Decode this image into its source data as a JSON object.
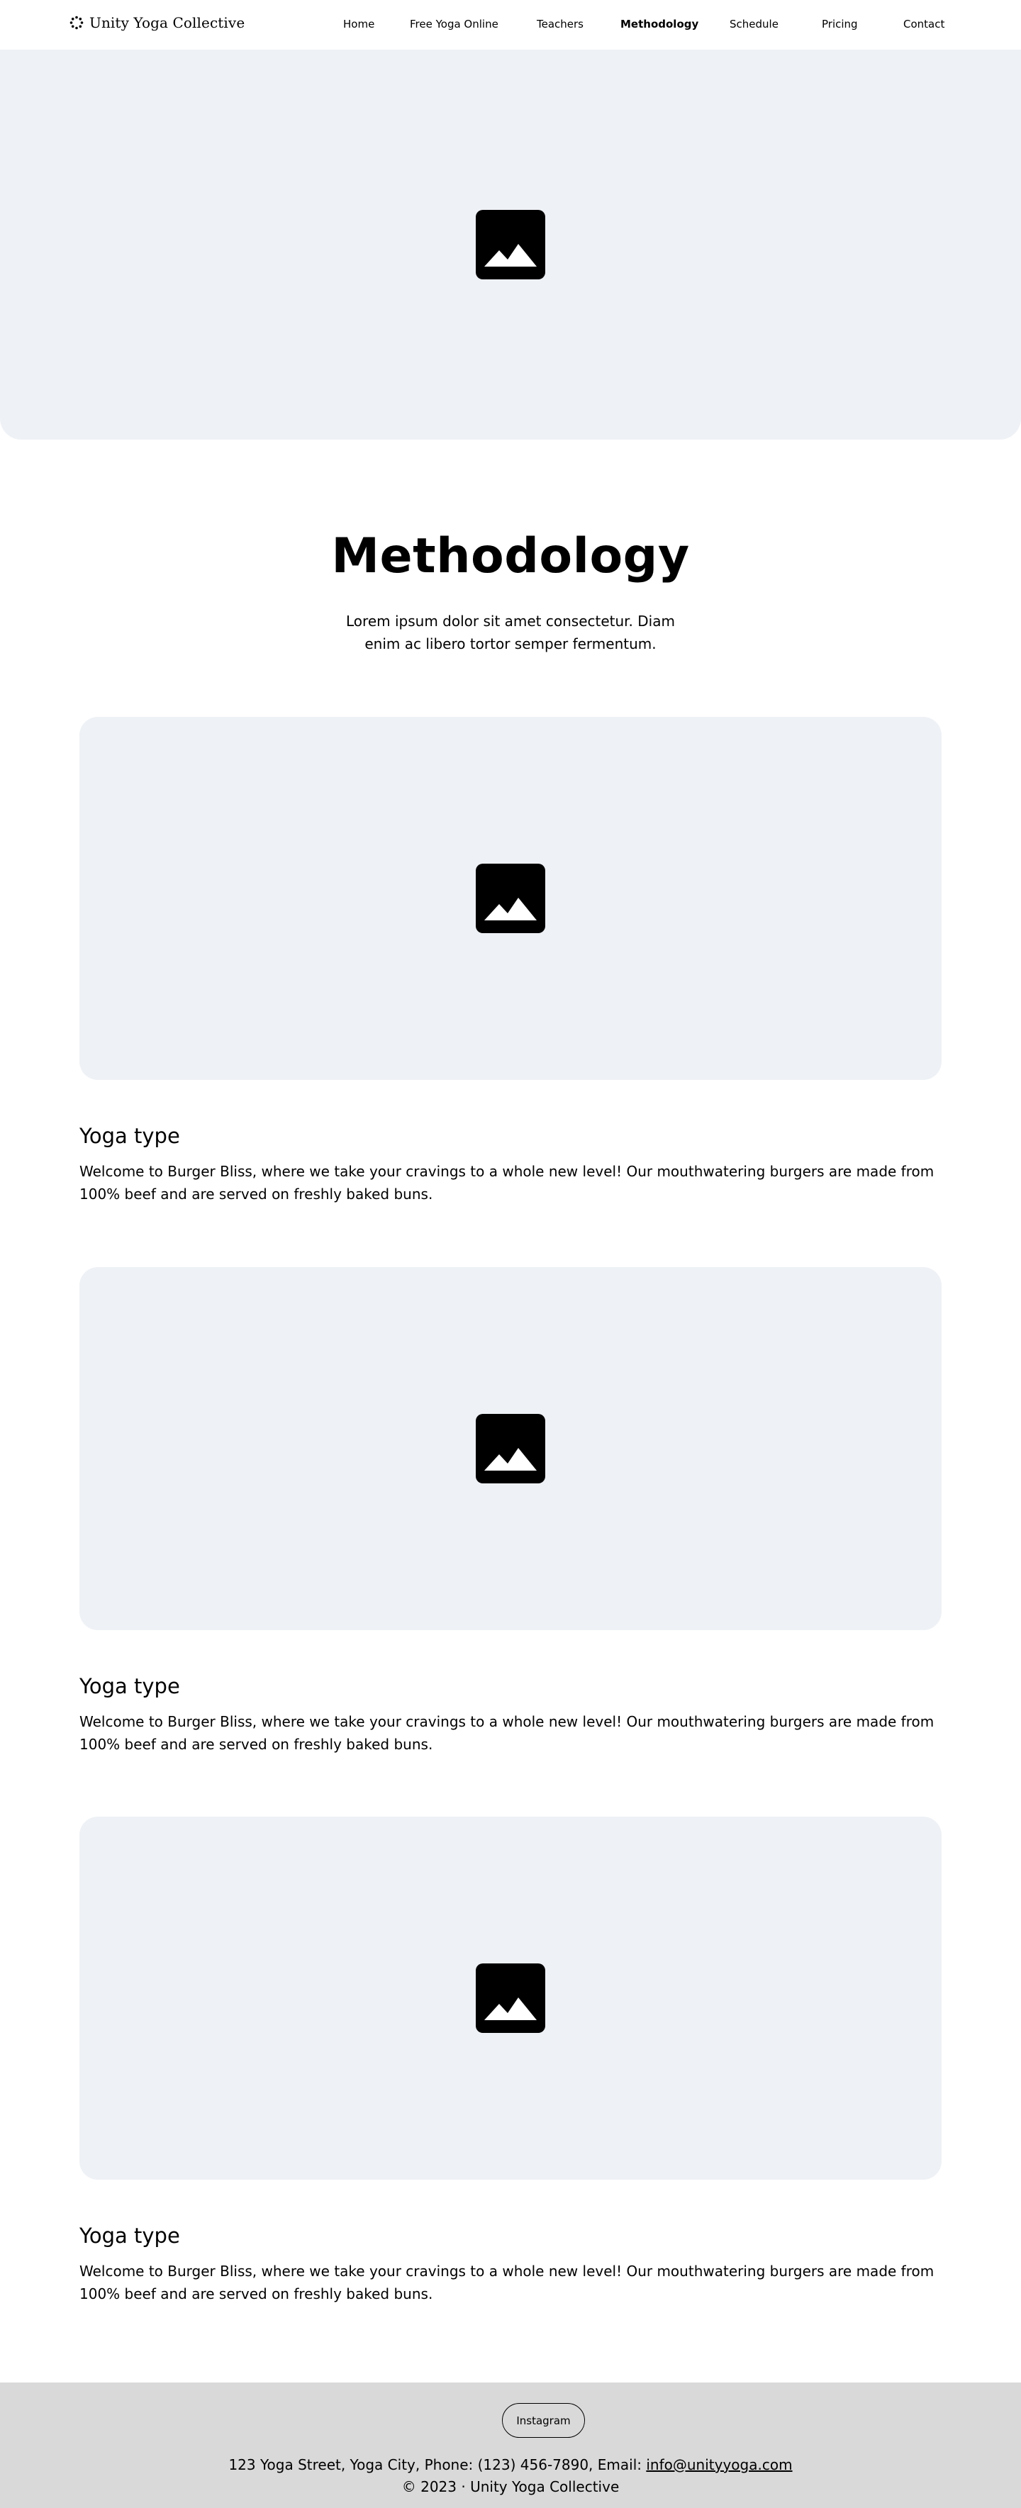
{
  "header": {
    "brand_name": "Unity Yoga Collective",
    "brand_icon": "circle-dots-logo-icon",
    "nav": [
      {
        "label": "Home"
      },
      {
        "label": "Free Yoga Online"
      },
      {
        "label": "Teachers"
      },
      {
        "label": "Methodology",
        "active": true
      },
      {
        "label": "Schedule"
      },
      {
        "label": "Pricing"
      },
      {
        "label": "Contact"
      }
    ]
  },
  "hero": {
    "icon": "image-placeholder-icon"
  },
  "section": {
    "title": "Methodology",
    "subtitle": "Lorem ipsum dolor sit amet consectetur. Diam enim ac libero tortor semper fermentum."
  },
  "cards": [
    {
      "title": "Yoga type",
      "text": "Welcome to Burger Bliss, where we take your cravings to a whole new level! Our mouthwatering burgers are made from 100% beef and are served on freshly baked buns.",
      "icon": "image-placeholder-icon"
    },
    {
      "title": "Yoga type",
      "text": "Welcome to Burger Bliss, where we take your cravings to a whole new level! Our mouthwatering burgers are made from 100% beef and are served on freshly baked buns.",
      "icon": "image-placeholder-icon"
    },
    {
      "title": "Yoga type",
      "text": "Welcome to Burger Bliss, where we take your cravings to a whole new level! Our mouthwatering burgers are made from 100% beef and are served on freshly baked buns.",
      "icon": "image-placeholder-icon"
    }
  ],
  "footer": {
    "instagram_label": "Instagram",
    "address_prefix": "123 Yoga Street, Yoga City, Phone: (123) 456-7890, Email: ",
    "email": "info@unityyoga.com",
    "copyright": "© 2023 · Unity Yoga Collective"
  },
  "colors": {
    "placeholder_bg": "#eef1f5",
    "footer_bg": "#d9d9d9",
    "text": "#000000"
  }
}
